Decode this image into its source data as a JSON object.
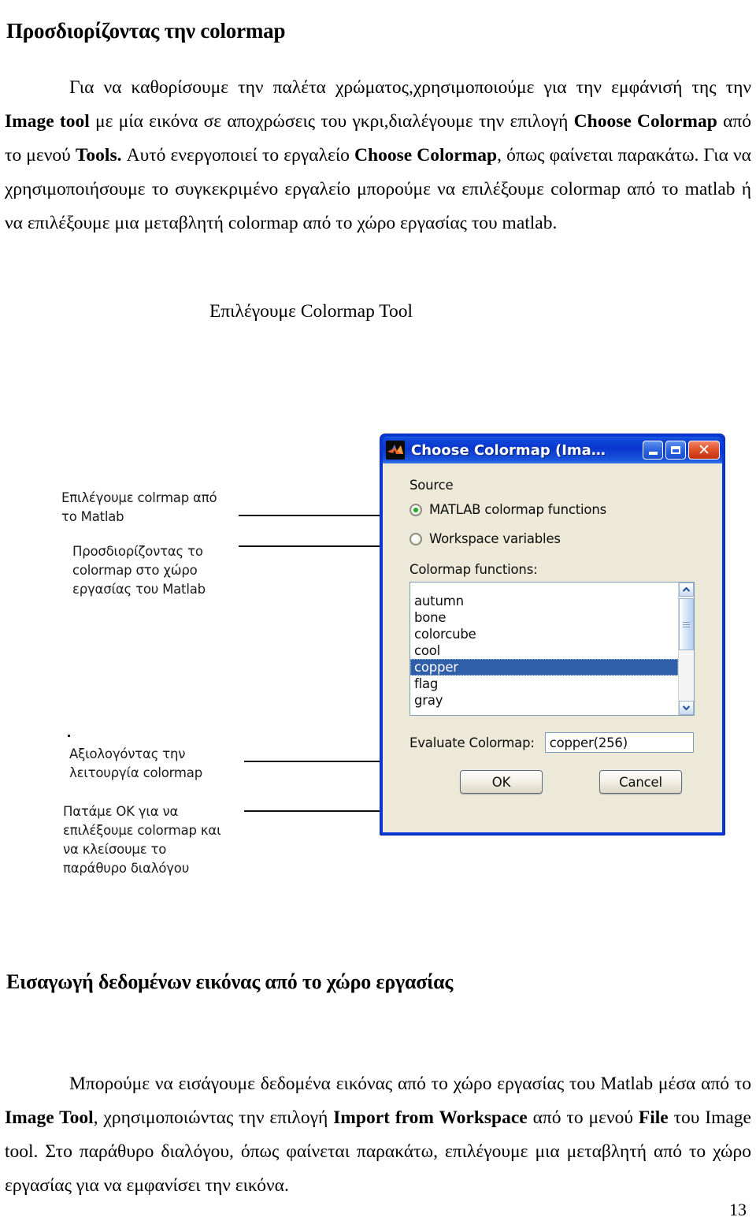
{
  "document": {
    "heading_top": "Προσδιορίζοντας την colormap",
    "paragraph_top_parts": [
      {
        "text": "Για να καθορίσουμε την παλέτα χρώματος,χρησιμοποιούμε για την εμφάνισή της την ",
        "bold": false
      },
      {
        "text": "Image tool",
        "bold": true
      },
      {
        "text": " με  μία εικόνα σε αποχρώσεις του γκρι,διαλέγουμε την επιλογή ",
        "bold": false
      },
      {
        "text": "Choose Colormap",
        "bold": true
      },
      {
        "text": " από το μενού ",
        "bold": false
      },
      {
        "text": "Tools.",
        "bold": true
      },
      {
        "text": " Αυτό ενεργοποιεί το εργαλείο ",
        "bold": false
      },
      {
        "text": "Choose Colormap",
        "bold": true
      },
      {
        "text": ", όπως φαίνεται παρακάτω. Για να χρησιμοποιήσουμε το συγκεκριμένο εργαλείο μπορούμε να επιλέξουμε colormap από το matlab ή να επιλέξουμε μια μεταβλητή colormap από το χώρο εργασίας του matlab.",
        "bold": false
      }
    ],
    "figure_caption": "Επιλέγουμε Colormap Tool",
    "heading_bottom": "Εισαγωγή δεδομένων εικόνας από το χώρο εργασίας",
    "paragraph_bottom_parts": [
      {
        "text": "Μπορούμε να εισάγουμε δεδομένα εικόνας από το χώρο εργασίας του Matlab μέσα από το ",
        "bold": false
      },
      {
        "text": "Image Tool",
        "bold": true
      },
      {
        "text": ", χρησιμοποιώντας την επιλογή ",
        "bold": false
      },
      {
        "text": "Import from Workspace",
        "bold": true
      },
      {
        "text": " από το μενού ",
        "bold": false
      },
      {
        "text": "File",
        "bold": true
      },
      {
        "text": " του Image tool. Στο παράθυρο διαλόγου, όπως φαίνεται παρακάτω, επιλέγουμε μια μεταβλητή από το χώρο εργασίας για να εμφανίσει την εικόνα.",
        "bold": false
      }
    ],
    "page_number": "13"
  },
  "figure": {
    "callouts": [
      {
        "id": "callout-1",
        "text": "Επιλέγουμε colrmap από\nτο Matlab"
      },
      {
        "id": "callout-2",
        "text": "Προσδιορίζοντας το\ncolormap στο χώρο\nεργασίας του Matlab"
      },
      {
        "id": "callout-3",
        "text": "Αξιολογόντας την\nλειτουργία colormap"
      },
      {
        "id": "callout-4",
        "text": "Πατάμε ΟΚ για να\nεπιλέξουμε colormap και\nνα κλείσουμε το\nπαράθυρο διαλόγου"
      }
    ]
  },
  "dialog": {
    "title": "Choose Colormap (Ima…",
    "icon_name": "matlab-logo-icon",
    "caption_buttons": {
      "minimize": "minimize-icon",
      "maximize": "maximize-icon",
      "close": "✕"
    },
    "source_label": "Source",
    "radios": [
      {
        "label": "MATLAB colormap functions",
        "checked": true
      },
      {
        "label": "Workspace variables",
        "checked": false
      }
    ],
    "colormap_functions_label": "Colormap functions:",
    "colormap_functions": [
      "autumn",
      "bone",
      "colorcube",
      "cool",
      "copper",
      "flag",
      "gray"
    ],
    "selected_colormap": "copper",
    "evaluate_label": "Evaluate Colormap:",
    "evaluate_value": "copper(256)",
    "buttons": {
      "ok": "OK",
      "cancel": "Cancel"
    },
    "colors": {
      "titlebar_blue": "#0a36d6",
      "dialog_face": "#ece9d8",
      "selection_blue": "#2f5fa8",
      "radio_dot_green": "#1faa22",
      "close_red": "#e2542c"
    }
  }
}
